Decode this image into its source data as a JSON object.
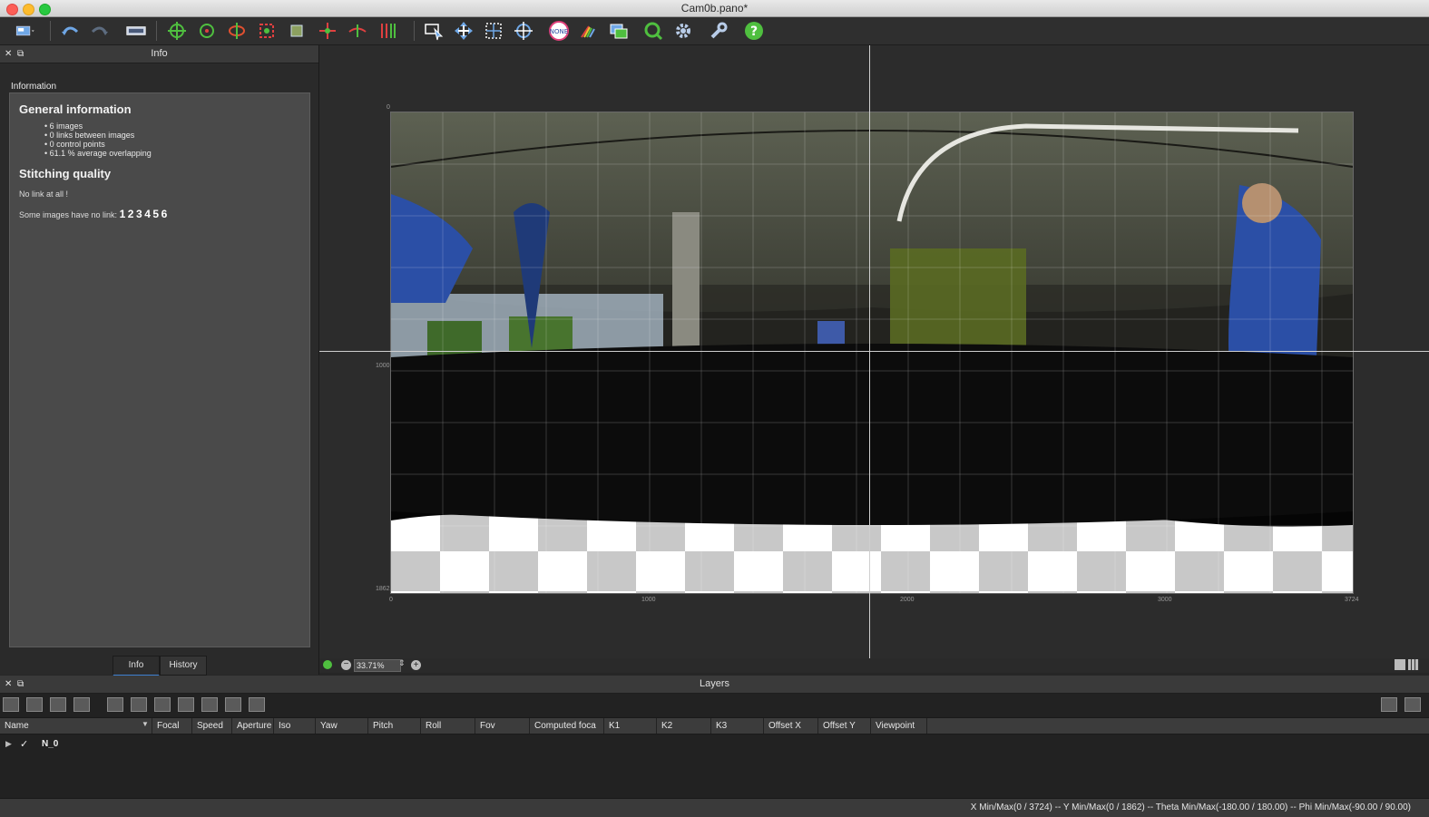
{
  "window": {
    "title": "Cam0b.pano*"
  },
  "info_panel": {
    "header": "Info",
    "section_label": "Information",
    "general_title": "General information",
    "general_items": [
      "6 images",
      "0 links between images",
      "0 control points",
      "61.1 % average overlapping"
    ],
    "quality_title": "Stitching quality",
    "no_link_text": "No link at all !",
    "no_link_images_label": "Some images have no link:",
    "no_link_images": [
      "1",
      "2",
      "3",
      "4",
      "5",
      "6"
    ],
    "tabs": [
      {
        "label": "Info"
      },
      {
        "label": "History"
      }
    ]
  },
  "viewer": {
    "x_ticks": [
      "0",
      "1000",
      "2000",
      "3000",
      "3724"
    ],
    "y_ticks": [
      "0",
      "1000",
      "1862"
    ],
    "zoom_value": "33.71%"
  },
  "layers": {
    "header": "Layers",
    "columns": [
      "Name",
      "Focal",
      "Speed",
      "Aperture",
      "Iso",
      "Yaw",
      "Pitch",
      "Roll",
      "Fov",
      "Computed foca",
      "K1",
      "K2",
      "K3",
      "Offset X",
      "Offset Y",
      "Viewpoint"
    ],
    "rows": [
      {
        "name": "N_0",
        "checked": true
      }
    ]
  },
  "status": {
    "text": "X Min/Max(0 / 3724)  --  Y Min/Max(0 / 1862)  --  Theta Min/Max(-180.00 / 180.00)  --  Phi Min/Max(-90.00 / 90.00)"
  },
  "colors": {
    "accent": "#3d7fd0",
    "panel": "#4a4a4a",
    "background": "#262626"
  },
  "toolbar_icons": [
    "project-menu-icon",
    "undo-icon",
    "redo-icon",
    "preview-icon",
    "crosshair-icon",
    "target-icon",
    "rotate-icon",
    "crop-icon",
    "square-icon",
    "control-point-icon",
    "horizon-icon",
    "vertical-lines-icon",
    "select-icon",
    "move-icon",
    "grid-icon",
    "center-icon",
    "none-icon",
    "color-icon",
    "layers-icon",
    "search-icon",
    "gear-icon",
    "wrench-icon",
    "help-icon"
  ]
}
